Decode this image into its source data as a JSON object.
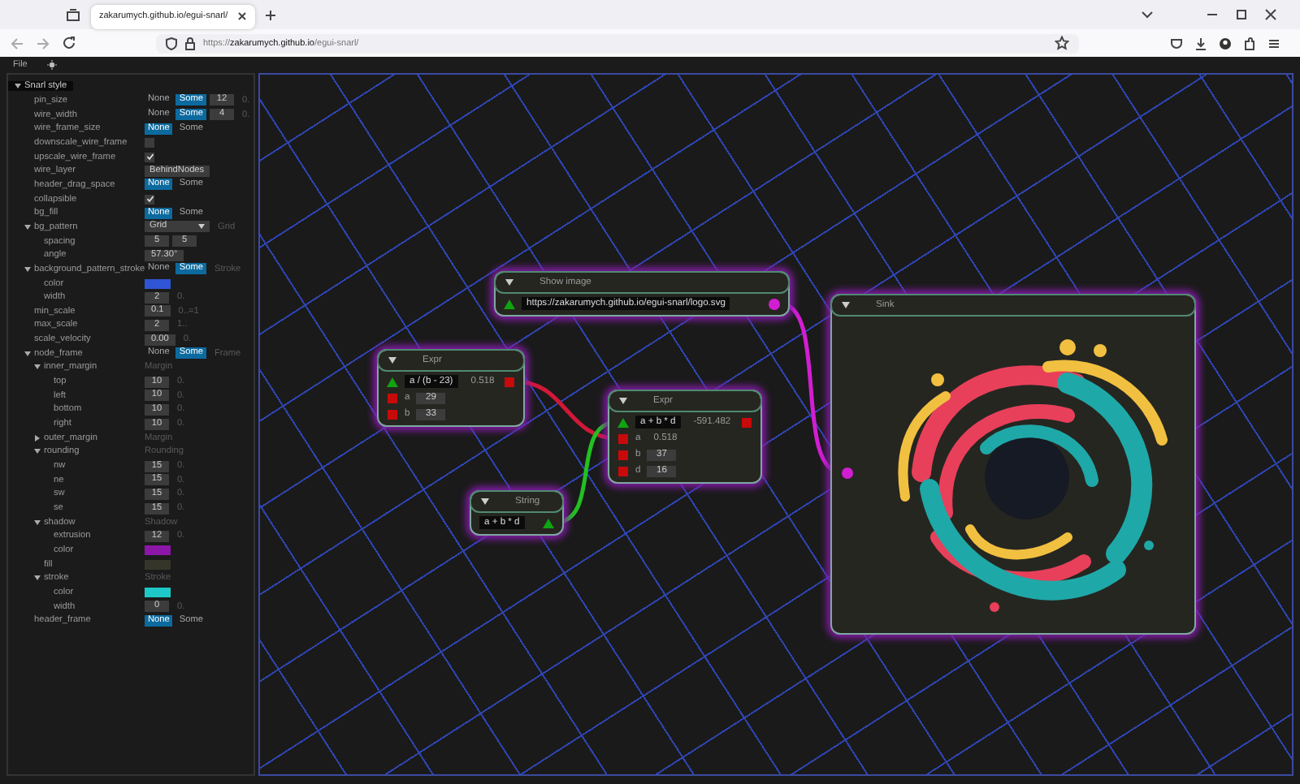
{
  "browser": {
    "tab": {
      "title": "zakarumych.github.io/egui-snarl/",
      "selected": true
    },
    "url": "https://**zakarumych.github.io**/egui-snarl/"
  },
  "menu_bar": {
    "items": [
      "File"
    ]
  },
  "style_panel": {
    "tree": [
      {
        "label": "Snarl style",
        "expanded": true,
        "children": [
          {
            "label": "pin_size",
            "control": {
              "kind": "option",
              "choices": [
                {
                  "label": "None",
                  "selected": false
                },
                {
                  "label": "Some",
                  "selected": true
                }
              ],
              "values": [
                "12"
              ],
              "hint": "0."
            }
          },
          {
            "label": "wire_width",
            "control": {
              "kind": "option",
              "choices": [
                {
                  "label": "None",
                  "selected": false
                },
                {
                  "label": "Some",
                  "selected": true
                }
              ],
              "values": [
                "4"
              ],
              "hint": "0."
            }
          },
          {
            "label": "wire_frame_size",
            "control": {
              "kind": "option",
              "choices": [
                {
                  "label": "None",
                  "selected": true
                },
                {
                  "label": "Some",
                  "selected": false
                }
              ]
            }
          },
          {
            "label": "downscale_wire_frame",
            "control": {
              "kind": "checkbox",
              "checked": false
            }
          },
          {
            "label": "upscale_wire_frame",
            "control": {
              "kind": "checkbox",
              "checked": true
            }
          },
          {
            "label": "wire_layer",
            "control": {
              "kind": "dropdown",
              "value": "BehindNodes"
            }
          },
          {
            "label": "header_drag_space",
            "control": {
              "kind": "option",
              "choices": [
                {
                  "label": "None",
                  "selected": true
                },
                {
                  "label": "Some",
                  "selected": false
                }
              ]
            }
          },
          {
            "label": "collapsible",
            "control": {
              "kind": "checkbox",
              "checked": true
            }
          },
          {
            "label": "bg_fill",
            "control": {
              "kind": "option",
              "choices": [
                {
                  "label": "None",
                  "selected": true
                },
                {
                  "label": "Some",
                  "selected": false
                }
              ]
            }
          },
          {
            "label": "bg_pattern",
            "expanded": true,
            "control": {
              "kind": "dropdown",
              "value": "Grid",
              "hint": "Grid"
            },
            "children": [
              {
                "label": "spacing",
                "control": {
                  "kind": "drag",
                  "values": [
                    "5",
                    "5"
                  ]
                }
              },
              {
                "label": "angle",
                "control": {
                  "kind": "drag",
                  "values": [
                    "57.30°"
                  ]
                }
              }
            ]
          },
          {
            "label": "background_pattern_stroke",
            "expanded": true,
            "control": {
              "kind": "option",
              "choices": [
                {
                  "label": "None",
                  "selected": false
                },
                {
                  "label": "Some",
                  "selected": true
                }
              ],
              "hint": "Stroke"
            },
            "children": [
              {
                "label": "color",
                "control": {
                  "kind": "color",
                  "color": "#2f55d4"
                }
              },
              {
                "label": "width",
                "control": {
                  "kind": "drag",
                  "values": [
                    "2"
                  ],
                  "hint": "0."
                }
              }
            ]
          },
          {
            "label": "min_scale",
            "control": {
              "kind": "drag",
              "values": [
                "0.1"
              ],
              "hint": "0..=1"
            }
          },
          {
            "label": "max_scale",
            "control": {
              "kind": "drag",
              "values": [
                "2"
              ],
              "hint": "1.."
            }
          },
          {
            "label": "scale_velocity",
            "control": {
              "kind": "drag",
              "values": [
                "0.00"
              ],
              "hint": "0."
            }
          },
          {
            "label": "node_frame",
            "expanded": true,
            "control": {
              "kind": "option",
              "choices": [
                {
                  "label": "None",
                  "selected": false
                },
                {
                  "label": "Some",
                  "selected": true
                }
              ],
              "hint": "Frame"
            },
            "children": [
              {
                "label": "inner_margin",
                "expanded": true,
                "control": {
                  "kind": "hint",
                  "hint": "Margin"
                },
                "children": [
                  {
                    "label": "top",
                    "control": {
                      "kind": "drag",
                      "values": [
                        "10"
                      ],
                      "hint": "0."
                    }
                  },
                  {
                    "label": "left",
                    "control": {
                      "kind": "drag",
                      "values": [
                        "10"
                      ],
                      "hint": "0."
                    }
                  },
                  {
                    "label": "bottom",
                    "control": {
                      "kind": "drag",
                      "values": [
                        "10"
                      ],
                      "hint": "0."
                    }
                  },
                  {
                    "label": "right",
                    "control": {
                      "kind": "drag",
                      "values": [
                        "10"
                      ],
                      "hint": "0."
                    }
                  }
                ]
              },
              {
                "label": "outer_margin",
                "expanded": false,
                "control": {
                  "kind": "hint",
                  "hint": "Margin"
                }
              },
              {
                "label": "rounding",
                "expanded": true,
                "control": {
                  "kind": "hint",
                  "hint": "Rounding"
                },
                "children": [
                  {
                    "label": "nw",
                    "control": {
                      "kind": "drag",
                      "values": [
                        "15"
                      ],
                      "hint": "0."
                    }
                  },
                  {
                    "label": "ne",
                    "control": {
                      "kind": "drag",
                      "values": [
                        "15"
                      ],
                      "hint": "0."
                    }
                  },
                  {
                    "label": "sw",
                    "control": {
                      "kind": "drag",
                      "values": [
                        "15"
                      ],
                      "hint": "0."
                    }
                  },
                  {
                    "label": "se",
                    "control": {
                      "kind": "drag",
                      "values": [
                        "15"
                      ],
                      "hint": "0."
                    }
                  }
                ]
              },
              {
                "label": "shadow",
                "expanded": true,
                "control": {
                  "kind": "hint",
                  "hint": "Shadow"
                },
                "children": [
                  {
                    "label": "extrusion",
                    "control": {
                      "kind": "drag",
                      "values": [
                        "12"
                      ],
                      "hint": "0."
                    }
                  },
                  {
                    "label": "color",
                    "control": {
                      "kind": "color",
                      "color": "#8c16a8"
                    }
                  }
                ]
              },
              {
                "label": "fill",
                "control": {
                  "kind": "color",
                  "color": "#35352a"
                }
              },
              {
                "label": "stroke",
                "expanded": true,
                "control": {
                  "kind": "hint",
                  "hint": "Stroke"
                },
                "children": [
                  {
                    "label": "color",
                    "control": {
                      "kind": "color",
                      "color": "#1ec8c8"
                    }
                  },
                  {
                    "label": "width",
                    "control": {
                      "kind": "drag",
                      "values": [
                        "0"
                      ],
                      "hint": "0."
                    }
                  }
                ]
              }
            ]
          },
          {
            "label": "header_frame",
            "control": {
              "kind": "option",
              "choices": [
                {
                  "label": "None",
                  "selected": true
                },
                {
                  "label": "Some",
                  "selected": false
                }
              ]
            }
          }
        ]
      }
    ]
  },
  "graph": {
    "nodes": [
      {
        "kind": "show_image",
        "title": "Show image",
        "expanded": true,
        "rows": [
          {
            "input": {
              "kind": "triangle",
              "color": "#10a410"
            },
            "field": "https://zakarumych.github.io/egui-snarl/logo.svg",
            "output": {
              "kind": "circle",
              "color": "#d21ed2"
            }
          }
        ]
      },
      {
        "kind": "expr",
        "title": "Expr",
        "expanded": true,
        "rows": [
          {
            "input": {
              "kind": "triangle",
              "color": "#10a410"
            },
            "field": "a / (b - 23)",
            "value": "0.518",
            "output": {
              "kind": "square",
              "color": "#c80a0a"
            }
          },
          {
            "input": {
              "kind": "square",
              "color": "#c80a0a"
            },
            "label": "a",
            "number": "29"
          },
          {
            "input": {
              "kind": "square",
              "color": "#c80a0a"
            },
            "label": "b",
            "number": "33"
          }
        ]
      },
      {
        "kind": "expr",
        "title": "Expr",
        "expanded": true,
        "rows": [
          {
            "input": {
              "kind": "triangle",
              "color": "#10a410"
            },
            "field": "a + b * d",
            "value": "-591.482",
            "output": {
              "kind": "square",
              "color": "#c80a0a"
            }
          },
          {
            "input": {
              "kind": "square",
              "color": "#c80a0a"
            },
            "label": "a",
            "value": "0.518"
          },
          {
            "input": {
              "kind": "square",
              "color": "#c80a0a"
            },
            "label": "b",
            "number": "37"
          },
          {
            "input": {
              "kind": "square",
              "color": "#c80a0a"
            },
            "label": "d",
            "number": "16"
          }
        ]
      },
      {
        "kind": "string",
        "title": "String",
        "expanded": true,
        "rows": [
          {
            "field": "a + b * d",
            "output": {
              "kind": "triangle",
              "color": "#10a410"
            }
          }
        ]
      },
      {
        "kind": "sink",
        "title": "Sink",
        "expanded": true,
        "rows": [
          {
            "input": {
              "kind": "circle",
              "color": "#d21ed2"
            }
          }
        ]
      }
    ],
    "wires": [
      {
        "color": "#d21ed2"
      },
      {
        "color": "#d01838"
      },
      {
        "color": "#22c022"
      }
    ]
  }
}
